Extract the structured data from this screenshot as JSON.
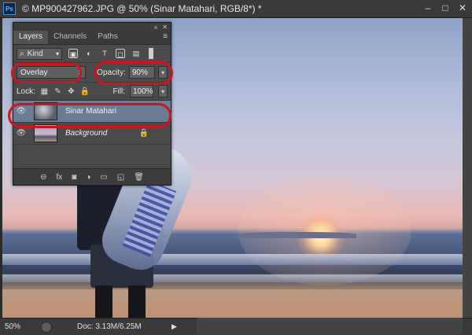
{
  "window": {
    "title": "© MP900427962.JPG @ 50% (Sinar Matahari, RGB/8*) *",
    "ps_logo": "Ps",
    "controls": [
      "–",
      "□",
      "✕"
    ]
  },
  "layers_panel": {
    "tabs": [
      {
        "label": "Layers",
        "active": true
      },
      {
        "label": "Channels",
        "active": false
      },
      {
        "label": "Paths",
        "active": false
      }
    ],
    "menu_icon": "≡",
    "collapse_icons": [
      "«",
      "✕"
    ],
    "filter": {
      "kind_label": "Kind",
      "search_icon": "⌕",
      "icons": [
        "▣",
        "◐",
        "T",
        "◻",
        "▤"
      ]
    },
    "blend_mode": "Overlay",
    "opacity_label": "Opacity:",
    "opacity_value": "90%",
    "lock_label": "Lock:",
    "fill_label": "Fill:",
    "fill_value": "100%",
    "layers": [
      {
        "name": "Sinar Matahari",
        "selected": true,
        "visible": true,
        "type": "smart"
      },
      {
        "name": "Background",
        "selected": false,
        "visible": true,
        "type": "background",
        "locked": true
      }
    ],
    "footer_icons": [
      "link-icon",
      "fx-icon",
      "mask-icon",
      "adjustment-icon",
      "folder-icon",
      "new-layer-icon",
      "trash-icon"
    ],
    "footer_glyphs": [
      "⊖",
      "fx",
      "◙",
      "◑",
      "▭",
      "◱",
      "🗑"
    ]
  },
  "status_bar": {
    "zoom": "50%",
    "doc_info": "Doc: 3.13M/6.25M",
    "arrow": "▶"
  },
  "annotation_color": "#d0141c",
  "selection_color": "#6a7d95"
}
